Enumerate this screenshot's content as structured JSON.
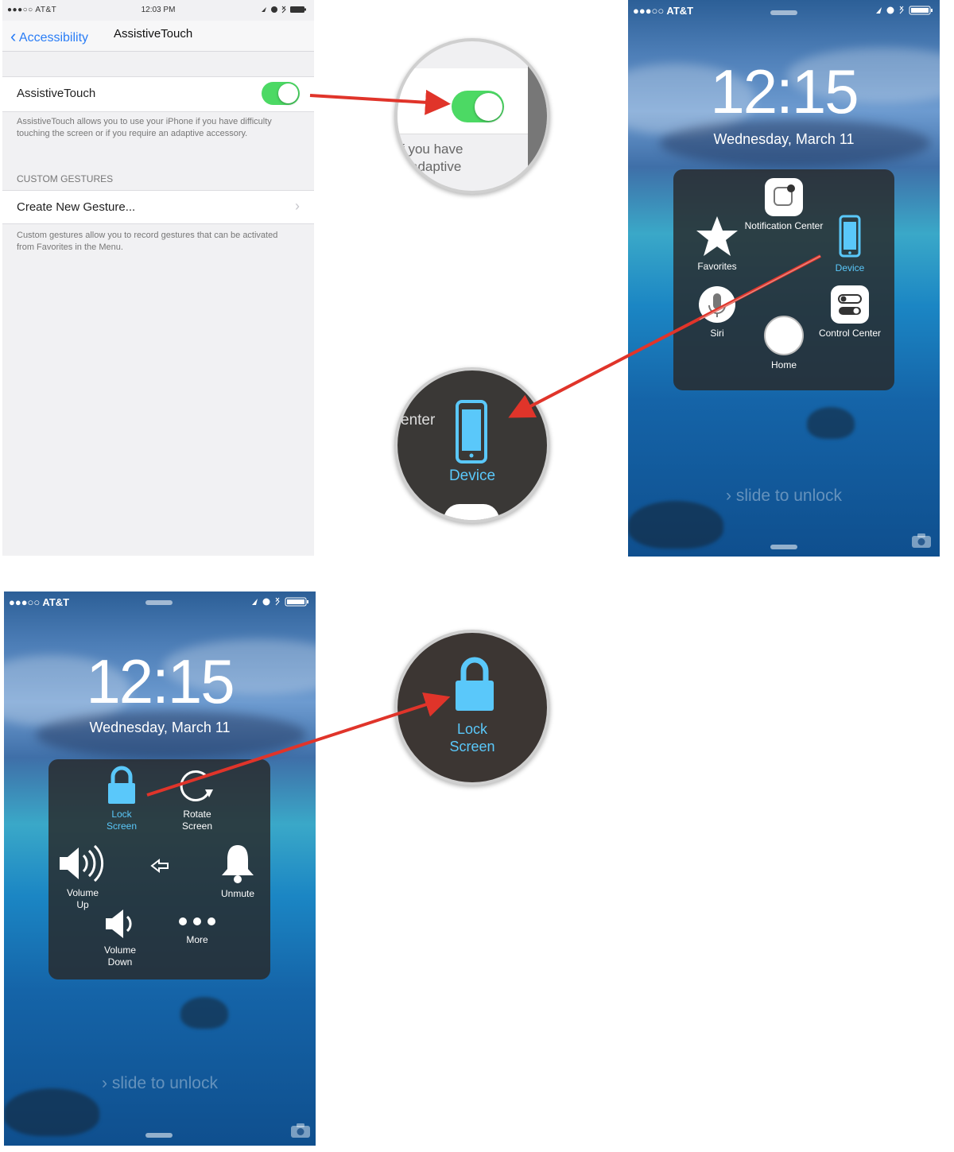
{
  "settings": {
    "status": {
      "carrier": "●●●○○ AT&T",
      "time": "12:03 PM"
    },
    "back_label": "Accessibility",
    "title": "AssistiveTouch",
    "toggle_label": "AssistiveTouch",
    "toggle_on": true,
    "toggle_footer": "AssistiveTouch allows you to use your iPhone if you have difficulty touching the screen or if you require an adaptive accessory.",
    "section_header": "CUSTOM GESTURES",
    "create_gesture": "Create New Gesture...",
    "gesture_footer": "Custom gestures allow you to record gestures that can be activated from Favorites in the Menu."
  },
  "zoom_toggle": {
    "line1": "f you have",
    "line2": "adaptive"
  },
  "lockscreen_main": {
    "carrier": "●●●○○ AT&T",
    "time": "12:15",
    "date": "Wednesday, March 11",
    "slide": "slide to unlock",
    "menu": {
      "notification_center": "Notification Center",
      "favorites": "Favorites",
      "device": "Device",
      "siri": "Siri",
      "control_center": "Control Center",
      "home": "Home"
    }
  },
  "zoom_device": {
    "partial": "enter",
    "label": "Device"
  },
  "lockscreen_device": {
    "carrier": "●●●○○ AT&T",
    "time": "12:15",
    "date": "Wednesday, March 11",
    "slide": "slide to unlock",
    "menu": {
      "lock_screen_1": "Lock",
      "lock_screen_2": "Screen",
      "rotate_1": "Rotate",
      "rotate_2": "Screen",
      "volume_up_1": "Volume",
      "volume_up_2": "Up",
      "unmute": "Unmute",
      "volume_down_1": "Volume",
      "volume_down_2": "Down",
      "more": "More"
    }
  },
  "zoom_lock": {
    "line1": "Lock",
    "line2": "Screen"
  },
  "colors": {
    "accent_blue": "#5ac8fa",
    "ios_blue": "#2a7df6",
    "switch_green": "#4cd964",
    "arrow_red": "#e0342a"
  }
}
